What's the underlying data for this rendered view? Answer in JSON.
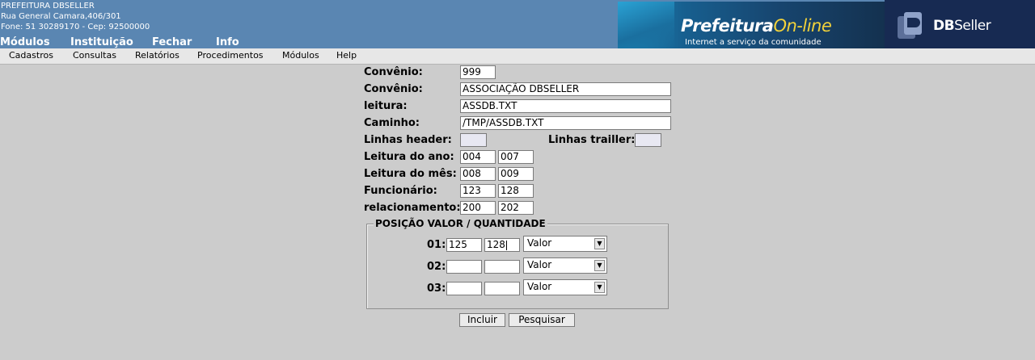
{
  "header": {
    "org_name": "PREFEITURA DBSELLER",
    "address": "Rua General Camara,406/301",
    "phone": "Fone: 51 30289170  -  Cep: 92500000",
    "nav": [
      "Módulos",
      "Instituição",
      "Fechar",
      "Info"
    ],
    "banner_title_a": "Prefeitura",
    "banner_title_b": "On-line",
    "banner_subtitle": "Internet a serviço da comunidade",
    "dbseller_a": "DB",
    "dbseller_b": "Seller",
    "colors": {
      "header_bg": "#5a86b2",
      "banner_accent": "#f2d23a",
      "dbseller_bg": "#172a52"
    }
  },
  "menubar": [
    "Cadastros",
    "Consultas",
    "Relatórios",
    "Procedimentos",
    "Módulos",
    "Help"
  ],
  "form": {
    "convenio_code_label": "Convênio:",
    "convenio_code": "999",
    "convenio_name_label": "Convênio:",
    "convenio_name": "ASSOCIAÇÃO DBSELLER",
    "leitura_label": "leitura:",
    "leitura": "ASSDB.TXT",
    "caminho_label": "Caminho:",
    "caminho": "/TMP/ASSDB.TXT",
    "linhas_header_label": "Linhas header:",
    "linhas_header": "",
    "linhas_trailler_label": "Linhas trailler:",
    "linhas_trailler": "",
    "leitura_ano_label": "Leitura do ano:",
    "leitura_ano": [
      "004",
      "007"
    ],
    "leitura_mes_label": "Leitura do mês:",
    "leitura_mes": [
      "008",
      "009"
    ],
    "funcionario_label": "Funcionário:",
    "funcionario": [
      "123",
      "128"
    ],
    "relacionamento_label": "relacionamento:",
    "relacionamento": [
      "200",
      "202"
    ]
  },
  "posicao": {
    "legend": "POSIÇÃO VALOR / QUANTIDADE",
    "rows": [
      {
        "label": "01:",
        "inicio": "125",
        "fim": "128",
        "tipo": "Valor"
      },
      {
        "label": "02:",
        "inicio": "",
        "fim": "",
        "tipo": "Valor"
      },
      {
        "label": "03:",
        "inicio": "",
        "fim": "",
        "tipo": "Valor"
      }
    ]
  },
  "buttons": {
    "incluir": "Incluir",
    "pesquisar": "Pesquisar"
  }
}
